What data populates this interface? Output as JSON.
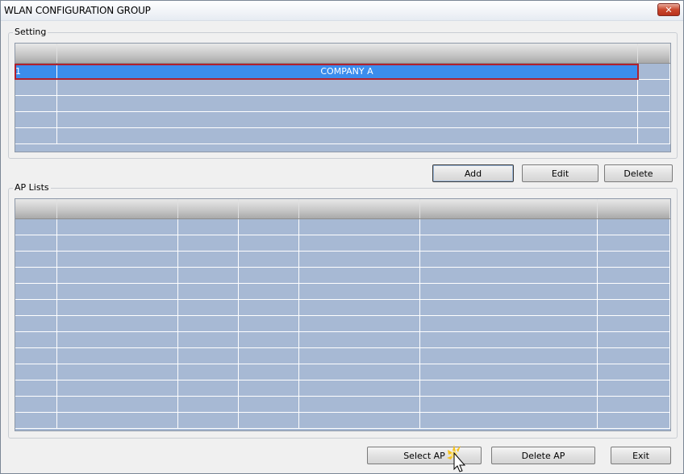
{
  "window": {
    "title": "WLAN CONFIGURATION GROUP",
    "close_glyph": "✕"
  },
  "setting": {
    "legend": "Setting",
    "rows": [
      {
        "num": "1",
        "name": "COMPANY A",
        "extra": ""
      },
      {
        "num": "",
        "name": "",
        "extra": ""
      },
      {
        "num": "",
        "name": "",
        "extra": ""
      },
      {
        "num": "",
        "name": "",
        "extra": ""
      },
      {
        "num": "",
        "name": "",
        "extra": ""
      }
    ],
    "selected_row": 0,
    "buttons": {
      "add": "Add",
      "edit": "Edit",
      "delete": "Delete"
    }
  },
  "ap_lists": {
    "legend": "AP Lists",
    "row_count": 13,
    "buttons": {
      "select_ap": "Select AP",
      "delete_ap": "Delete AP",
      "exit": "Exit"
    }
  },
  "colors": {
    "grid_bg": "#a7b9d4",
    "selected_row": "#3b8ded",
    "selection_outline": "#b0202d",
    "close_button": "#c9462c"
  },
  "icons": {
    "close": "close-icon",
    "cursor": "mouse-pointer-icon"
  }
}
